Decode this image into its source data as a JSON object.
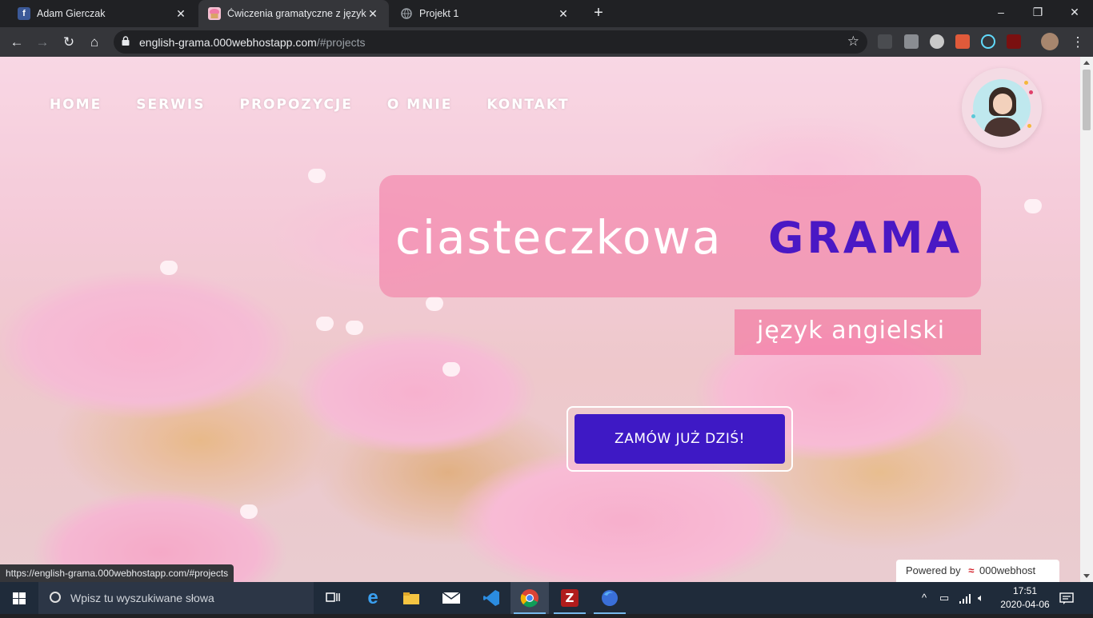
{
  "browser": {
    "tabs": [
      {
        "title": "Adam Gierczak",
        "icon": "facebook-icon"
      },
      {
        "title": "Ćwiczenia gramatyczne z języka a",
        "icon": "cupcake-icon"
      },
      {
        "title": "Projekt 1",
        "icon": "globe-icon"
      }
    ],
    "new_tab": "+",
    "window": {
      "minimize": "–",
      "maximize": "❐",
      "close": "✕"
    },
    "url_host": "english-grama.000webhostapp.com",
    "url_path": "/#projects",
    "status_url": "https://english-grama.000webhostapp.com/#projects"
  },
  "nav": {
    "items": [
      "HOME",
      "SERWIS",
      "PROPOZYCJE",
      "O MNIE",
      "KONTAKT"
    ]
  },
  "hero": {
    "title": "ciasteczkowa",
    "brand": "GRAMA",
    "subtitle": "język angielski",
    "cta": "ZAMÓW JUŻ DZIŚ!"
  },
  "powered": {
    "label": "Powered by",
    "brand": "000webhost"
  },
  "taskbar": {
    "search_placeholder": "Wpisz tu wyszukiwane słowa",
    "time": "17:51",
    "date": "2020-04-06"
  },
  "colors": {
    "brand_purple": "#4a18c4",
    "cta": "#3e19c5",
    "hero_pink": "#f376a0"
  }
}
